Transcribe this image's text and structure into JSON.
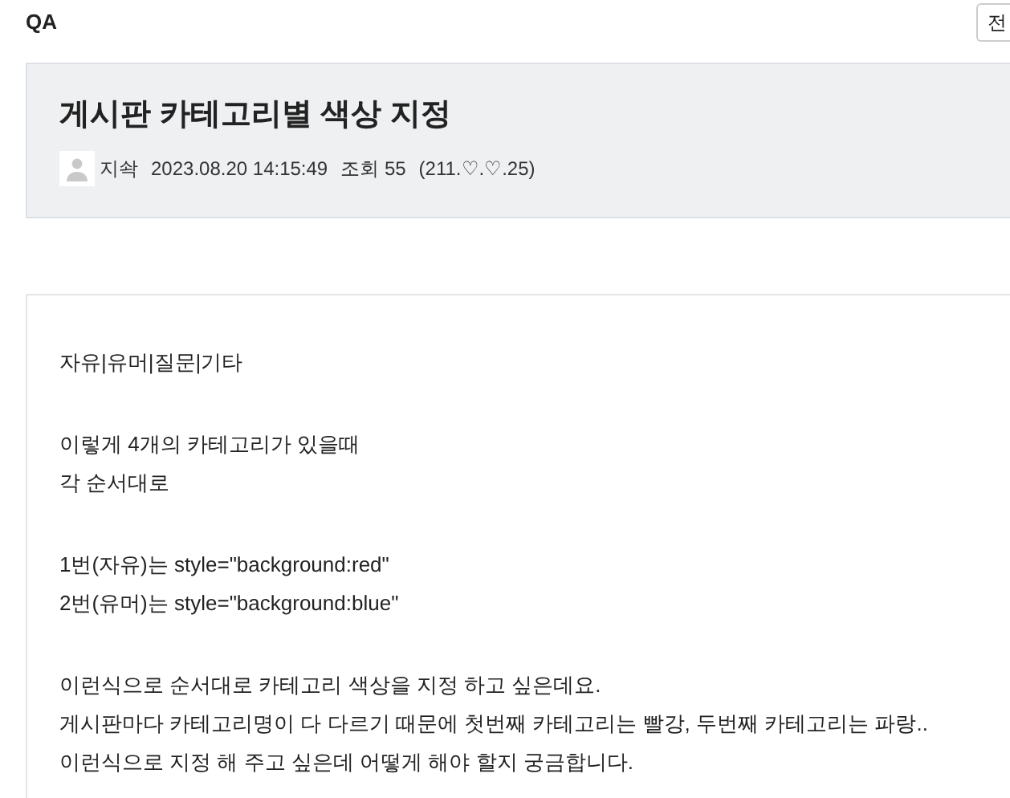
{
  "board_title": "QA",
  "top_button": "전",
  "post": {
    "title": "게시판 카테고리별 색상 지정",
    "author": "지솩",
    "date": "2023.08.20 14:15:49",
    "views_label": "조회",
    "views": "55",
    "ip": "(211.♡.♡.25)"
  },
  "body": [
    [
      "자유|유머|질문|기타"
    ],
    [
      "이렇게 4개의 카테고리가 있을때",
      "각 순서대로"
    ],
    [
      "1번(자유)는 style=\"background:red\"",
      "2번(유머)는 style=\"background:blue\""
    ],
    [
      "이런식으로 순서대로 카테고리 색상을 지정 하고 싶은데요.",
      "게시판마다 카테고리명이 다 다르기 때문에 첫번째 카테고리는 빨강, 두번째 카테고리는 파랑..",
      "이런식으로 지정 해 주고 싶은데 어떻게 해야 할지 궁금합니다."
    ]
  ]
}
